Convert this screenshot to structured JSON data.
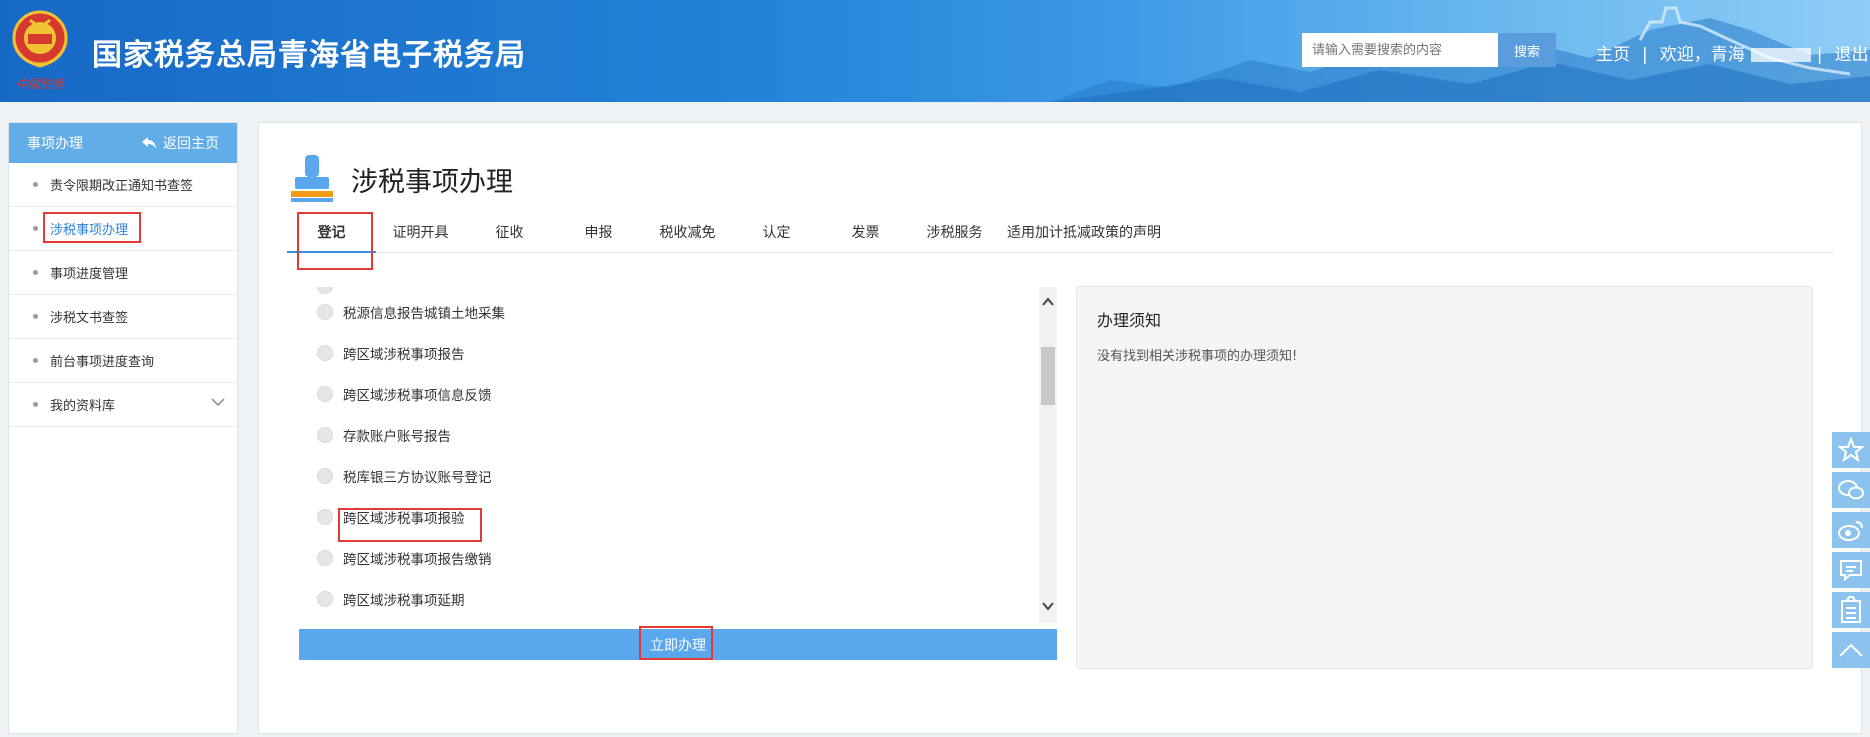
{
  "header": {
    "title": "国家税务总局青海省电子税务局",
    "search_placeholder": "请输入需要搜索的内容",
    "search_button": "搜索",
    "home_link": "主页",
    "welcome": "欢迎，青海",
    "logout": "退出"
  },
  "sidebar": {
    "title": "事项办理",
    "back": "返回主页",
    "items": [
      {
        "label": "责令限期改正通知书查签"
      },
      {
        "label": "涉税事项办理"
      },
      {
        "label": "事项进度管理"
      },
      {
        "label": "涉税文书查签"
      },
      {
        "label": "前台事项进度查询"
      },
      {
        "label": "我的资料库"
      }
    ]
  },
  "main": {
    "title": "涉税事项办理",
    "tabs": [
      "登记",
      "证明开具",
      "征收",
      "申报",
      "税收减免",
      "认定",
      "发票",
      "涉税服务",
      "适用加计抵减政策的声明"
    ],
    "items": [
      "税源信息报告城镇土地采集",
      "跨区域涉税事项报告",
      "跨区域涉税事项信息反馈",
      "存款账户账号报告",
      "税库银三方协议账号登记",
      "跨区域涉税事项报验",
      "跨区域涉税事项报告缴销",
      "跨区域涉税事项延期"
    ],
    "submit": "立即办理",
    "notice_title": "办理须知",
    "notice_text": "没有找到相关涉税事项的办理须知!"
  },
  "colors": {
    "accent": "#3a8ee6",
    "sidebar_head": "#62ade8",
    "highlight_box": "#e53935"
  }
}
